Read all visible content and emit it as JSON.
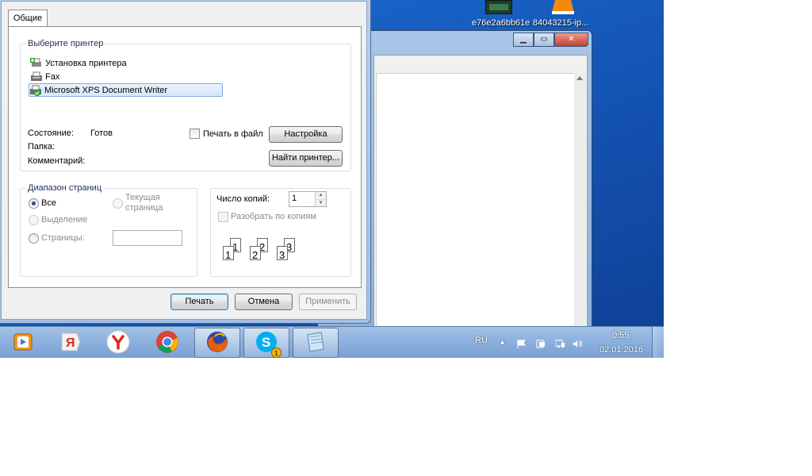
{
  "desktop": {
    "icon_labels": [
      "e76e2a6bb61e",
      "84043215-ip..."
    ]
  },
  "dialog": {
    "tab_label": "Общие",
    "select_printer_title": "Выберите принтер",
    "printers": [
      {
        "name": "Установка принтера",
        "icon": "add-printer-icon"
      },
      {
        "name": "Fax",
        "icon": "fax-icon"
      },
      {
        "name": "Microsoft XPS Document Writer",
        "icon": "xps-printer-icon",
        "selected": true
      }
    ],
    "status_label": "Состояние:",
    "status_value": "Готов",
    "location_label": "Папка:",
    "comment_label": "Комментарий:",
    "print_to_file_label": "Печать в файл",
    "print_to_file_checked": false,
    "preferences_button": "Настройка",
    "find_printer_button": "Найти принтер...",
    "page_range": {
      "title": "Диапазон страниц",
      "all_label": "Все",
      "selection_label": "Выделение",
      "current_page_label_line1": "Текущая",
      "current_page_label_line2": "страница",
      "pages_label": "Страницы:",
      "pages_value": "",
      "selected_option": "all"
    },
    "copies": {
      "label": "Число копий:",
      "value": "1",
      "collate_label": "Разобрать по копиям",
      "collate_checked": false,
      "collate_digits": [
        "1",
        "1",
        "2",
        "2",
        "3",
        "3"
      ]
    },
    "buttons": {
      "print": "Печать",
      "cancel": "Отмена",
      "apply": "Применить"
    }
  },
  "background_window": {
    "minimize": "minimize-icon",
    "maximize": "maximize-icon",
    "close": "close-icon"
  },
  "taskbar": {
    "apps": [
      "media-player-icon",
      "yandex-icon",
      "yandex-browser-icon",
      "chrome-icon",
      "firefox-icon",
      "skype-icon",
      "notepad-icon"
    ],
    "skype_badge": "1",
    "language": "RU",
    "time": "0:55",
    "date": "02.01.2016"
  },
  "colors": {
    "desktop_blue": "#1557b8",
    "taskbar": "#8fb3df",
    "selection": "#d6e8fb",
    "group_title": "#1e2b5d"
  }
}
